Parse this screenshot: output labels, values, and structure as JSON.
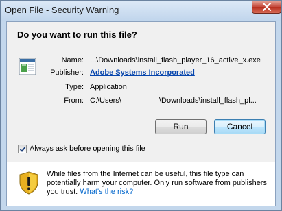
{
  "window": {
    "title": "Open File - Security Warning",
    "close_icon": "close-icon"
  },
  "dialog": {
    "heading": "Do you want to run this file?",
    "file_icon": "executable-file-icon",
    "fields": {
      "name_label": "Name:",
      "name_value": "...\\Downloads\\install_flash_player_16_active_x.exe",
      "publisher_label": "Publisher:",
      "publisher_value": "Adobe Systems Incorporated",
      "type_label": "Type:",
      "type_value": "Application",
      "from_label": "From:",
      "from_value_start": "C:\\Users\\",
      "from_value_end": "\\Downloads\\install_flash_pl..."
    },
    "buttons": {
      "run": "Run",
      "cancel": "Cancel"
    },
    "checkbox": {
      "label": "Always ask before opening this file",
      "checked": true
    },
    "warning": {
      "icon": "shield-warning-icon",
      "text": "While files from the Internet can be useful, this file type can potentially harm your computer. Only run software from publishers you trust.",
      "link": "What's the risk?"
    }
  },
  "colors": {
    "frame": "#c3d7ec",
    "close_button": "#c4483a",
    "link": "#0645ad",
    "default_button_border": "#3c7fb1"
  }
}
